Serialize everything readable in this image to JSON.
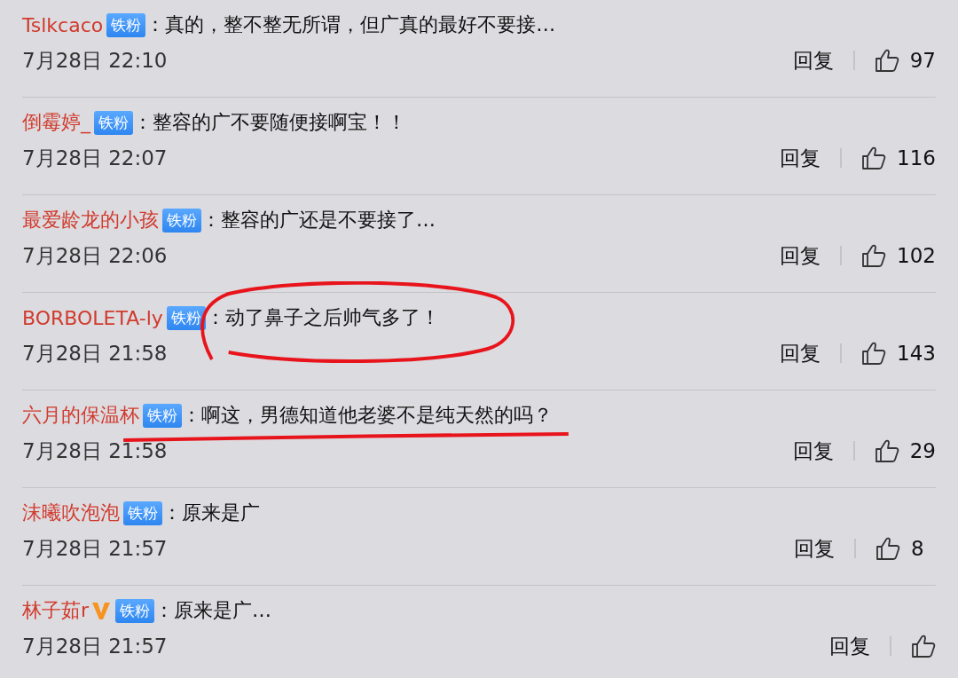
{
  "comments": [
    {
      "user": "Tslkcaco",
      "verified": false,
      "badge": "铁粉",
      "separator": "：",
      "text": "真的，整不整无所谓，但广真的最好不要接…",
      "time": "7月28日 22:10",
      "reply": "回复",
      "likes": "97"
    },
    {
      "user": "倒霉婷_",
      "verified": false,
      "badge": "铁粉",
      "separator": "：",
      "text": "整容的广不要随便接啊宝！！",
      "time": "7月28日 22:07",
      "reply": "回复",
      "likes": "116"
    },
    {
      "user": "最爱龄龙的小孩",
      "verified": false,
      "badge": "铁粉",
      "separator": "：",
      "text": "整容的广还是不要接了…",
      "time": "7月28日 22:06",
      "reply": "回复",
      "likes": "102"
    },
    {
      "user": "BORBOLETA-ly",
      "verified": false,
      "badge": "铁粉",
      "separator": "：",
      "text": "动了鼻子之后帅气多了！",
      "time": "7月28日 21:58",
      "reply": "回复",
      "likes": "143",
      "circled": true
    },
    {
      "user": "六月的保温杯",
      "verified": false,
      "badge": "铁粉",
      "separator": "：",
      "text": "啊这，男德知道他老婆不是纯天然的吗？",
      "time": "7月28日 21:58",
      "reply": "回复",
      "likes": "29",
      "underlined": true
    },
    {
      "user": "沫曦吹泡泡",
      "verified": false,
      "badge": "铁粉",
      "separator": "：",
      "text": "原来是广",
      "time": "7月28日 21:57",
      "reply": "回复",
      "likes": "8"
    },
    {
      "user": "林子茹r",
      "verified": true,
      "badge": "铁粉",
      "separator": "：",
      "text": "原来是广…",
      "time": "7月28日 21:57",
      "reply": "回复"
    }
  ]
}
